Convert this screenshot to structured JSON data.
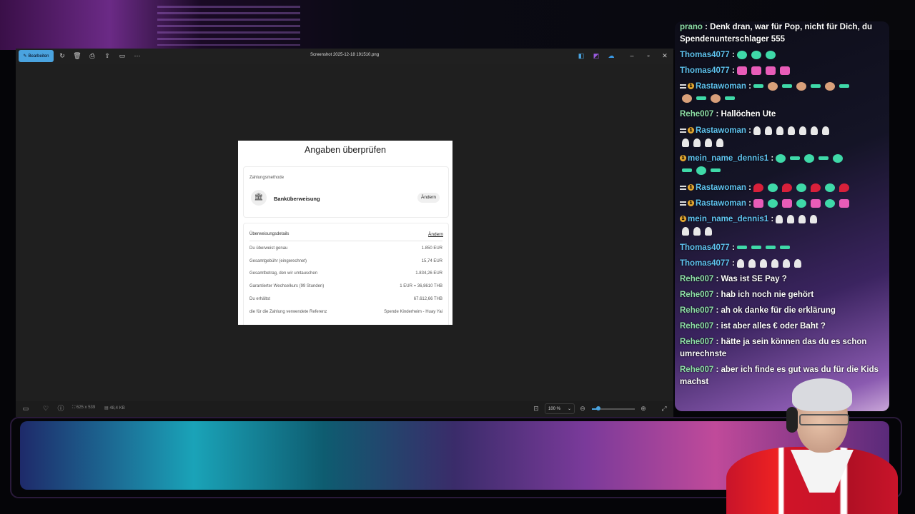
{
  "window": {
    "edit_label": "Bearbeiten",
    "title": "Screenshot 2025-12-18 191510.png",
    "toolbar_icons": [
      "rotate-icon",
      "delete-icon",
      "print-icon",
      "share-icon",
      "slideshow-icon",
      "more-icon"
    ],
    "app_icons": [
      "paint-icon",
      "clipchamp-icon",
      "onedrive-icon"
    ],
    "status": {
      "dimensions": "625 x 539",
      "filesize": "48,4 KB",
      "zoom": "100 %",
      "zoom_level": 0.15
    }
  },
  "doc": {
    "title": "Angaben überprüfen",
    "payment_method_label": "Zahlungsmethode",
    "bank_name": "Banküberweisung",
    "change_label": "Ändern",
    "transfer_details_label": "Überweisungsdetails",
    "transfer_change_label": "Ändern",
    "rows": [
      {
        "label": "Du überweist genau",
        "value": "1.850 EUR"
      },
      {
        "label": "Gesamtgebühr (eingerechnet)",
        "value": "15,74 EUR"
      },
      {
        "label": "Gesamtbetrag, den wir umtauschen",
        "value": "1.834,26 EUR"
      },
      {
        "label": "Garantierter Wechselkurs (99 Stunden)",
        "value": "1 EUR = 36,8610 THB"
      },
      {
        "label": "Du erhältst",
        "value": "67.612,66 THB"
      },
      {
        "label": "die für die Zahlung verwendete Referenz",
        "value": "Spende Kinderheim - Huay Yai"
      }
    ]
  },
  "chat": {
    "messages": [
      {
        "user": "prano",
        "text": ": Denk dran, war für Pop, nicht für Dich, du Spendenunterschlager 555"
      },
      {
        "user": "Thomas4077",
        "text": ":"
      },
      {
        "user": "Thomas4077",
        "text": ":"
      },
      {
        "user": "Rastawoman",
        "text": ":"
      },
      {
        "user": "Rehe007",
        "text": ": Hallöchen Ute"
      },
      {
        "user": "Rastawoman",
        "text": ":"
      },
      {
        "user": "mein_name_dennis1",
        "text": ":"
      },
      {
        "user": "Rastawoman",
        "text": ":"
      },
      {
        "user": "Rastawoman",
        "text": ":"
      },
      {
        "user": "mein_name_dennis1",
        "text": ":"
      },
      {
        "user": "Thomas4077",
        "text": ":"
      },
      {
        "user": "Thomas4077",
        "text": ":"
      },
      {
        "user": "Rehe007",
        "text": ": Was ist SE Pay ?"
      },
      {
        "user": "Rehe007",
        "text": ": hab ich noch nie gehört"
      },
      {
        "user": "Rehe007",
        "text": ": ah ok danke für die erklärung"
      },
      {
        "user": "Rehe007",
        "text": ": ist aber alles € oder Baht ?"
      },
      {
        "user": "Rehe007",
        "text": ": hätte ja sein können das du es schon umrechnste"
      },
      {
        "user": "Rehe007",
        "text": ": aber ich finde es gut was du für die Kids machst"
      }
    ]
  }
}
